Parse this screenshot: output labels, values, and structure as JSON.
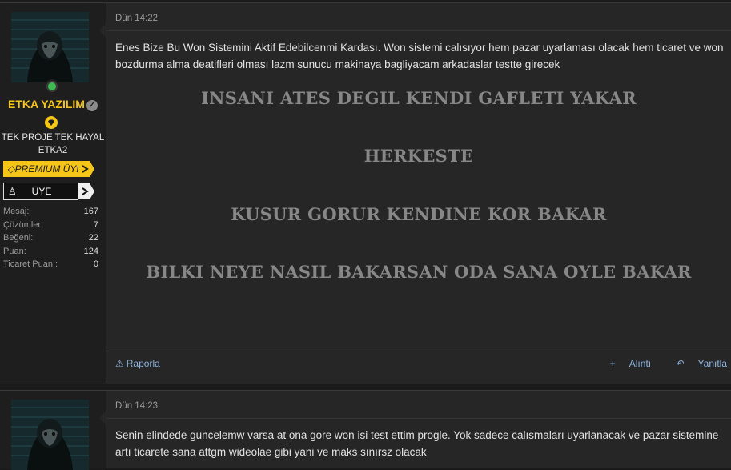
{
  "posts": [
    {
      "user": {
        "name": "ETKA YAZILIM",
        "title_line1": "TEK PROJE TEK HAYAL",
        "title_line2": "ETKA2",
        "banner_premium": "PREMIUM ÜYE",
        "banner_member": "ÜYE",
        "stats": [
          {
            "label": "Mesaj:",
            "value": "167"
          },
          {
            "label": "Çözümler:",
            "value": "7"
          },
          {
            "label": "Beğeni:",
            "value": "22"
          },
          {
            "label": "Puan:",
            "value": "124"
          },
          {
            "label": "Ticaret Puanı:",
            "value": "0"
          }
        ]
      },
      "date": "Dün 14:22",
      "text": "Enes Bize Bu Won Sistemini Aktif Edebilcenmi Kardası. Won sistemi calısıyor hem pazar uyarlaması olacak hem ticaret ve won bozdurma alma deatifleri olması lazm sunucu makinaya bagliyacam arkadaslar testte girecek",
      "signature": [
        "INSANI ATES DEGIL KENDI GAFLETI YAKAR",
        "HERKESTE",
        "KUSUR GORUR KENDINE KOR BAKAR",
        "BILKI NEYE NASIL BAKARSAN ODA SANA OYLE BAKAR"
      ],
      "footer": {
        "report": "Raporla",
        "quote": "Alıntı",
        "reply": "Yanıtla"
      }
    },
    {
      "date": "Dün 14:23",
      "text": "Senin elindede guncelemw varsa at ona gore won isi test ettim progle. Yok sadece calısmaları uyarlanacak ve pazar sistemine artı ticarete sana attgm wideolae gibi yani ve maks sınırsz olacak"
    }
  ],
  "colors": {
    "username": "#f5c518",
    "premium_banner": "#f5c518",
    "link": "#8db3de",
    "online": "#3fb950"
  },
  "icons": [
    "user-online-icon",
    "verified-icon",
    "diamond-icon",
    "user-icon",
    "warning-icon",
    "plus-icon",
    "reply-icon"
  ]
}
